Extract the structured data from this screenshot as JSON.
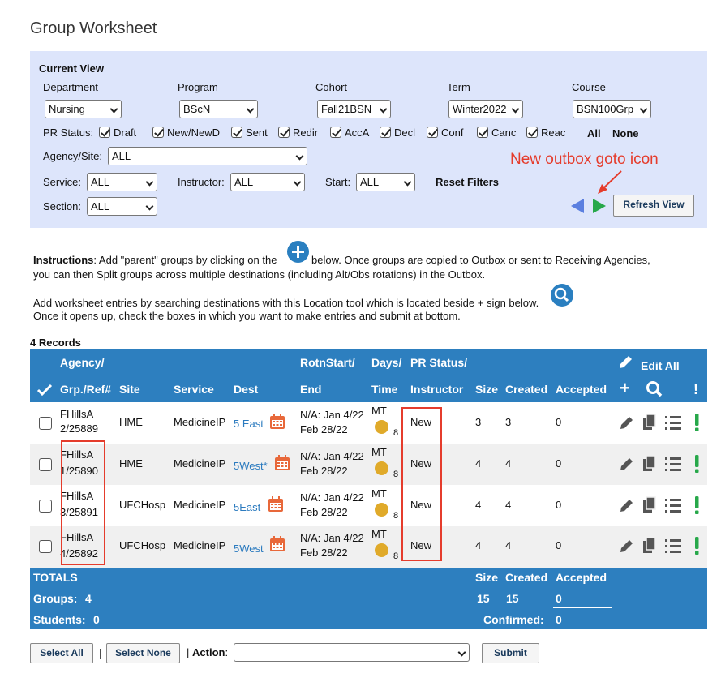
{
  "page": {
    "title": "Group Worksheet"
  },
  "filters": {
    "heading": "Current View",
    "department": {
      "label": "Department",
      "value": "Nursing"
    },
    "program": {
      "label": "Program",
      "value": "BScN"
    },
    "cohort": {
      "label": "Cohort",
      "value": "Fall21BSN"
    },
    "term": {
      "label": "Term",
      "value": "Winter2022"
    },
    "course": {
      "label": "Course",
      "value": "BSN100Grp"
    },
    "pr_status": {
      "label": "PR Status:",
      "options": [
        "Draft",
        "New/NewD",
        "Sent",
        "Redir",
        "AccA",
        "Decl",
        "Conf",
        "Canc",
        "Reac"
      ],
      "all_label": "All",
      "none_label": "None"
    },
    "agency_site": {
      "label": "Agency/Site:",
      "value": "ALL"
    },
    "service": {
      "label": "Service:",
      "value": "ALL"
    },
    "instructor": {
      "label": "Instructor:",
      "value": "ALL"
    },
    "start": {
      "label": "Start:",
      "value": "ALL"
    },
    "reset_label": "Reset Filters",
    "section": {
      "label": "Section:",
      "value": "ALL"
    },
    "refresh_label": "Refresh View"
  },
  "annotation": {
    "text": "New outbox goto icon"
  },
  "instructions": {
    "bold_label": "Instructions",
    "line1a": ":  Add \"parent\" groups by clicking on the",
    "line1b": "below. Once groups are copied to Outbox or sent to Receiving Agencies,",
    "line2": "you can then Split groups across multiple destinations (including Alt/Obs rotations) in the Outbox.",
    "line3": "Add worksheet entries by searching destinations with this Location tool which is located beside + sign below.",
    "line4": "Once it opens up, check the boxes in which you want to make entries and submit at bottom."
  },
  "records_label": "4 Records",
  "table": {
    "headers": {
      "agency": "Agency/",
      "grp_ref": "Grp./Ref#",
      "site": "Site",
      "service": "Service",
      "dest": "Dest",
      "rotn_start": "RotnStart/",
      "end": "End",
      "days": "Days/",
      "time": "Time",
      "pr_status": "PR Status/",
      "instructor": "Instructor",
      "size": "Size",
      "created": "Created",
      "accepted": "Accepted",
      "edit_all": "Edit All",
      "plus": "+",
      "bang": "!"
    },
    "rows": [
      {
        "agency": "FHillsA",
        "ref": "2/25889",
        "site": "HME",
        "service": "MedicineIP",
        "dest": "5 East",
        "start": "N/A: Jan 4/22",
        "end": "Feb 28/22",
        "days": "MT",
        "time_num": "8",
        "status": "New",
        "size": "3",
        "created": "3",
        "accepted": "0"
      },
      {
        "agency": "FHillsA",
        "ref": "1/25890",
        "site": "HME",
        "service": "MedicineIP",
        "dest": "5West*",
        "start": "N/A: Jan 4/22",
        "end": "Feb 28/22",
        "days": "MT",
        "time_num": "8",
        "status": "New",
        "size": "4",
        "created": "4",
        "accepted": "0"
      },
      {
        "agency": "FHillsA",
        "ref": "3/25891",
        "site": "UFCHosp",
        "service": "MedicineIP",
        "dest": "5East",
        "start": "N/A: Jan 4/22",
        "end": "Feb 28/22",
        "days": "MT",
        "time_num": "8",
        "status": "New",
        "size": "4",
        "created": "4",
        "accepted": "0"
      },
      {
        "agency": "FHillsA",
        "ref": "4/25892",
        "site": "UFCHosp",
        "service": "MedicineIP",
        "dest": "5West",
        "start": "N/A: Jan 4/22",
        "end": "Feb 28/22",
        "days": "MT",
        "time_num": "8",
        "status": "New",
        "size": "4",
        "created": "4",
        "accepted": "0"
      }
    ],
    "totals": {
      "label": "TOTALS",
      "groups_label": "Groups:",
      "groups_value": "4",
      "students_label": "Students:",
      "students_value": "0",
      "size_label": "Size",
      "created_label": "Created",
      "accepted_label": "Accepted",
      "size_value": "15",
      "created_value": "15",
      "accepted_value": "0",
      "confirmed_label": "Confirmed:",
      "confirmed_value": "0"
    }
  },
  "footer": {
    "select_all": "Select All",
    "separator": "|",
    "select_none": "Select None",
    "action_label": "Action",
    "action_prefix": "|",
    "action_colon": ":",
    "action_value": "",
    "submit": "Submit"
  },
  "colors": {
    "panel_bg": "#dde5fb",
    "header_blue": "#2d7fbf",
    "link_blue": "#2c7bbf",
    "annotation_red": "#e53c2c",
    "exclaim_green": "#27a84a",
    "calendar_orange": "#e8683a",
    "clock_gold": "#e0aa2a"
  }
}
